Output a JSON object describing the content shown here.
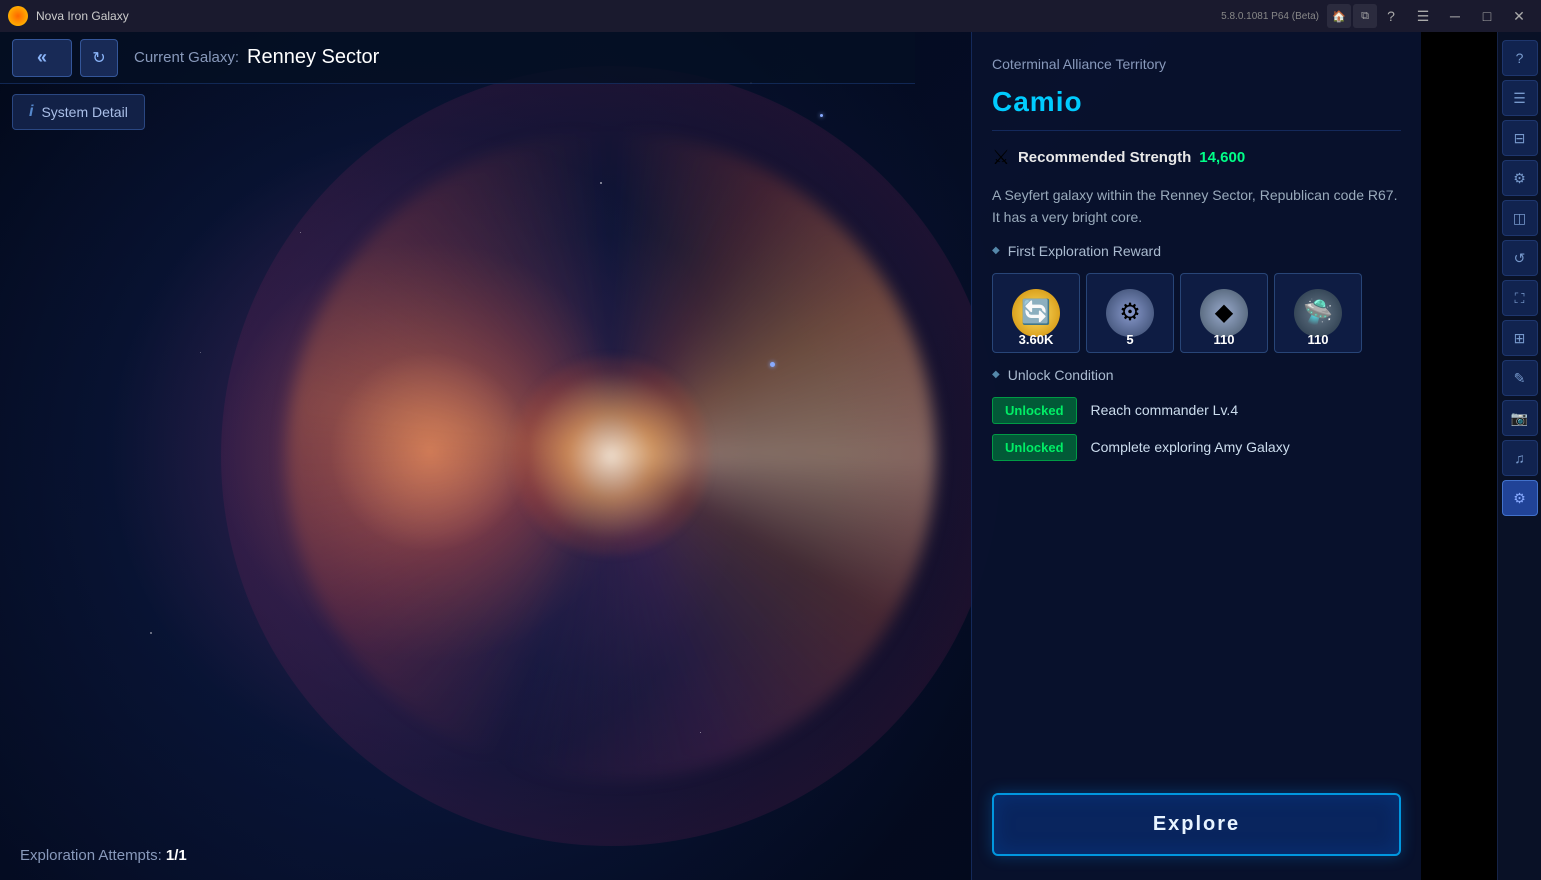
{
  "titlebar": {
    "app_name": "Nova Iron Galaxy",
    "version": "5.8.0.1081 P64 (Beta)",
    "home_icon": "🏠",
    "copy_icon": "⧉"
  },
  "nav": {
    "back_label": "«",
    "refresh_icon": "↻",
    "current_galaxy_prefix": "Current Galaxy:",
    "current_galaxy_name": "Renney Sector"
  },
  "system_detail_btn": "System Detail",
  "exploration_attempts": {
    "label": "Exploration Attempts:",
    "value": "1/1"
  },
  "panel": {
    "territory": "Coterminal Alliance Territory",
    "planet_name": "Camio",
    "strength_label": "Recommended Strength",
    "strength_value": "14,600",
    "description": "A Seyfert galaxy within the Renney Sector, Republican code R67. It has a very bright core.",
    "first_exploration_reward_label": "First Exploration Reward",
    "rewards": [
      {
        "icon": "🔄",
        "value": "3.60K",
        "type": "gold"
      },
      {
        "icon": "⚙",
        "value": "5",
        "type": "gear"
      },
      {
        "icon": "◆",
        "value": "110",
        "type": "crystal"
      },
      {
        "icon": "🛸",
        "value": "110",
        "type": "drone"
      }
    ],
    "unlock_condition_label": "Unlock Condition",
    "unlock_conditions": [
      {
        "badge": "Unlocked",
        "condition": "Reach commander Lv.4"
      },
      {
        "badge": "Unlocked",
        "condition": "Complete exploring Amy Galaxy"
      }
    ],
    "explore_btn_label": "Explore"
  },
  "sidebar_icons": [
    {
      "icon": "?",
      "name": "help-icon"
    },
    {
      "icon": "☰",
      "name": "menu-icon"
    },
    {
      "icon": "⊟",
      "name": "minimize-icon"
    },
    {
      "icon": "⚙",
      "name": "settings-icon"
    },
    {
      "icon": "◫",
      "name": "layout-icon"
    },
    {
      "icon": "↺",
      "name": "rotate-icon"
    },
    {
      "icon": "⛶",
      "name": "fullscreen-icon"
    },
    {
      "icon": "⊞",
      "name": "grid-icon"
    },
    {
      "icon": "✎",
      "name": "edit-icon"
    },
    {
      "icon": "📷",
      "name": "camera-icon"
    },
    {
      "icon": "♫",
      "name": "audio-icon"
    },
    {
      "icon": "⚙",
      "name": "gear2-icon"
    }
  ]
}
